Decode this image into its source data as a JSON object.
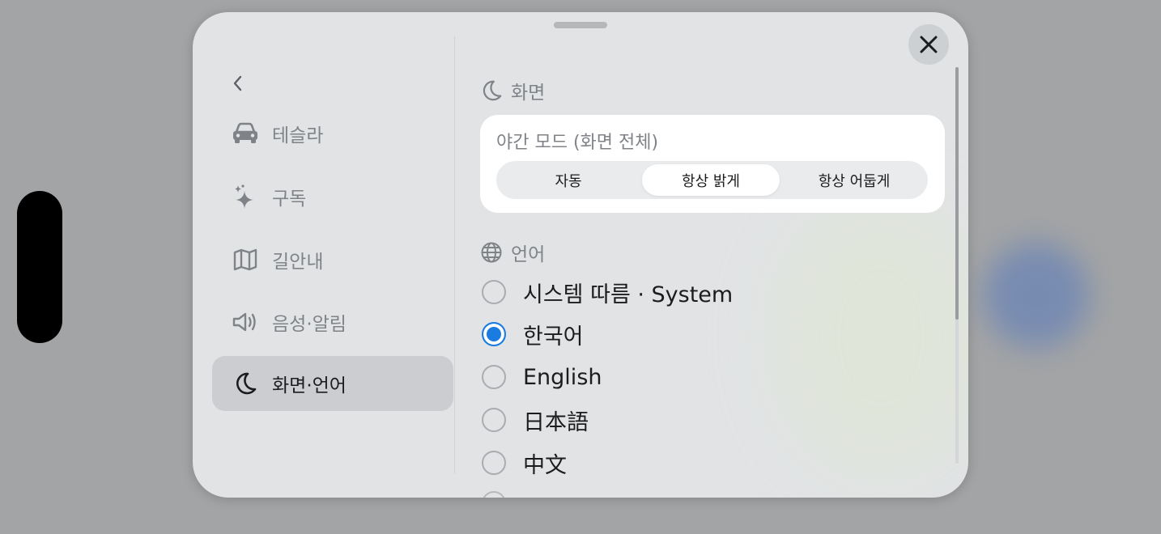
{
  "colors": {
    "sheet_bg": "#e1e3e5",
    "selected_nav_bg": "#cbcdd0",
    "accent_blue": "#1a7be0",
    "muted_text": "#7f8388",
    "primary_text": "#1b1c1e"
  },
  "icons": {
    "close": "close-icon",
    "back": "chevron-left-icon",
    "display": "moon-icon",
    "language": "globe-icon"
  },
  "sidebar": {
    "items": [
      {
        "label": "테슬라",
        "icon": "car-icon",
        "selected": false
      },
      {
        "label": "구독",
        "icon": "sparkle-icon",
        "selected": false
      },
      {
        "label": "길안내",
        "icon": "map-icon",
        "selected": false
      },
      {
        "label": "음성·알림",
        "icon": "speaker-icon",
        "selected": false
      },
      {
        "label": "화면·언어",
        "icon": "moon-icon",
        "selected": true
      }
    ]
  },
  "main": {
    "display_section": {
      "title": "화면",
      "night_mode": {
        "title": "야간 모드 (화면 전체)",
        "options": [
          "자동",
          "항상 밝게",
          "항상 어둡게"
        ],
        "selected": "항상 밝게"
      }
    },
    "language_section": {
      "title": "언어",
      "options": [
        {
          "label": "시스템 따름 · System",
          "checked": false
        },
        {
          "label": "한국어",
          "checked": true
        },
        {
          "label": "English",
          "checked": false
        },
        {
          "label": "日本語",
          "checked": false
        },
        {
          "label": "中文",
          "checked": false
        }
      ]
    }
  }
}
